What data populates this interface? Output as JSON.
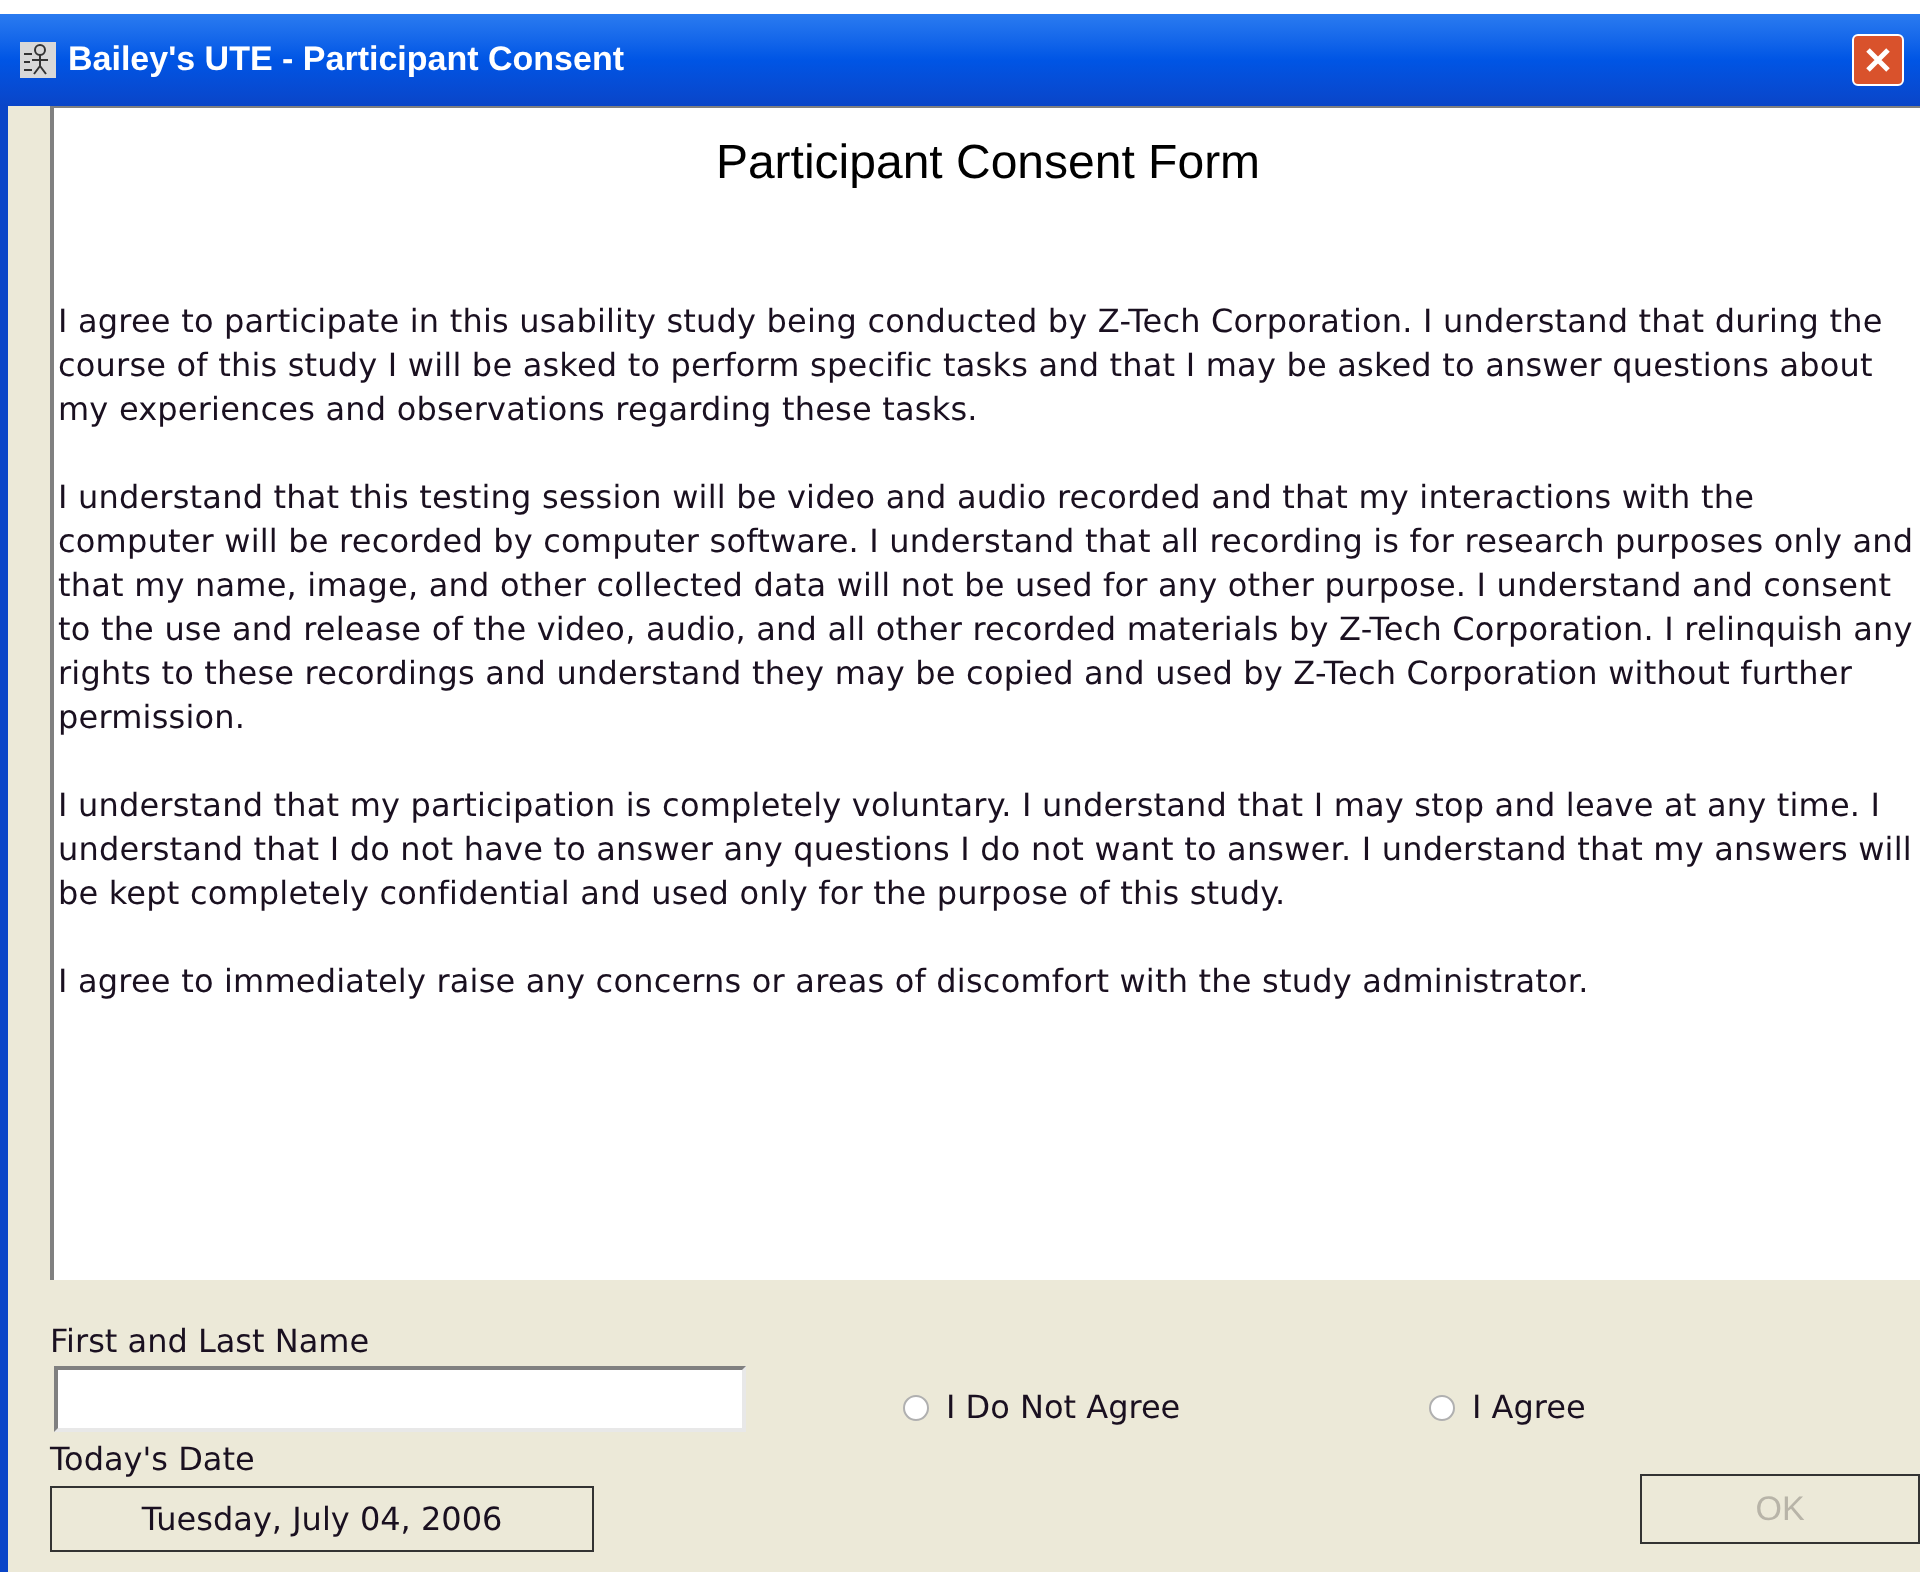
{
  "window": {
    "title": "Bailey's UTE - Participant Consent"
  },
  "heading": "Participant Consent Form",
  "paragraphs": [
    "I agree to participate in this usability study being conducted by Z-Tech Corporation. I understand that during the course of this study I will be asked to perform specific tasks and that I may be asked to answer questions about my experiences and observations regarding these tasks.",
    "I understand that this testing session will be video and audio recorded and that my interactions with the computer will be recorded by computer software.  I understand that all recording is for research purposes only and that my name, image, and other collected data will not be used for any other purpose.  I understand and consent to the use and release of the video, audio, and all other recorded materials by Z-Tech Corporation. I relinquish any rights to these recordings and understand they may be copied and used by Z-Tech Corporation without further permission.",
    "I understand that my participation is completely voluntary.  I understand that I may stop and leave at any time.  I understand that I do not have to answer any questions I do not want to answer.  I understand that my answers will be kept completely confidential and used only for the purpose of this study.",
    "I agree to immediately raise any concerns or areas of discomfort with the study administrator."
  ],
  "name_field": {
    "label": "First and Last Name"
  },
  "choices": [
    {
      "label": "I Do Not Agree",
      "selected": false
    },
    {
      "label": "I Agree",
      "selected": false
    }
  ],
  "date": {
    "label": "Today's Date",
    "value": "Tuesday, July 04, 2006"
  },
  "ok_button": {
    "label": "OK",
    "disabled": true
  }
}
